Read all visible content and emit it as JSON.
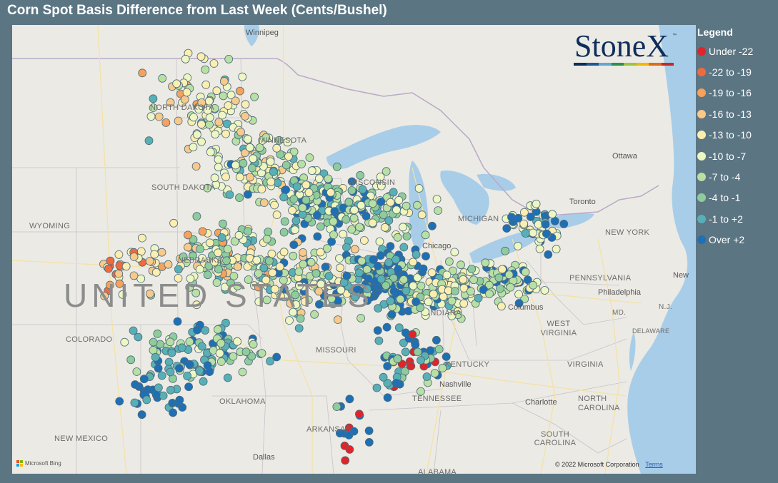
{
  "title": "Corn Spot Basis Difference from Last Week (Cents/Bushel)",
  "logo": {
    "text": "StoneX",
    "tm": "™",
    "bar_colors": [
      "#0e2d5a",
      "#1d5a99",
      "#5fa8d3",
      "#2f8f4e",
      "#9bc53d",
      "#f2b705",
      "#e06c1b",
      "#c62828"
    ]
  },
  "legend": {
    "title": "Legend",
    "items": [
      {
        "label": "Under -22",
        "color": "#e0242a"
      },
      {
        "label": "-22 to -19",
        "color": "#ee6a40"
      },
      {
        "label": "-19 to -16",
        "color": "#f6a15c"
      },
      {
        "label": "-16 to -13",
        "color": "#f8c98a"
      },
      {
        "label": "-13 to -10",
        "color": "#fbeeb0"
      },
      {
        "label": "-10 to -7",
        "color": "#eef6c4"
      },
      {
        "label": "-7 to -4",
        "color": "#b9e0a4"
      },
      {
        "label": "-4 to -1",
        "color": "#8fcc9c"
      },
      {
        "label": "-1 to +2",
        "color": "#58b0b6"
      },
      {
        "label": "Over +2",
        "color": "#1f6fb5"
      }
    ]
  },
  "map": {
    "country_label": "UNITED STATES",
    "state_labels": [
      {
        "id": "north-dakota",
        "text": "NORTH DAKOTA"
      },
      {
        "id": "minnesota",
        "text": "MINNESOTA"
      },
      {
        "id": "south-dakota",
        "text": "SOUTH DAKOTA"
      },
      {
        "id": "wyoming",
        "text": "WYOMING"
      },
      {
        "id": "nebraska",
        "text": "NEBRASKA"
      },
      {
        "id": "colorado",
        "text": "COLORADO"
      },
      {
        "id": "missouri",
        "text": "MISSOURI"
      },
      {
        "id": "oklahoma",
        "text": "OKLAHOMA"
      },
      {
        "id": "new-mexico",
        "text": "NEW MEXICO"
      },
      {
        "id": "arkansas",
        "text": "ARKANSAS"
      },
      {
        "id": "kentucky",
        "text": "KENTUCKY"
      },
      {
        "id": "tennessee",
        "text": "TENNESSEE"
      },
      {
        "id": "west-virginia",
        "text": "WEST VIRGINIA"
      },
      {
        "id": "virginia",
        "text": "VIRGINIA"
      },
      {
        "id": "north-carolina",
        "text": "NORTH CAROLINA"
      },
      {
        "id": "south-carolina",
        "text": "SOUTH CAROLINA"
      },
      {
        "id": "pennsylvania",
        "text": "PENNSYLVANIA"
      },
      {
        "id": "new-york",
        "text": "NEW YORK"
      },
      {
        "id": "md",
        "text": "MD."
      },
      {
        "id": "nj",
        "text": "N.J."
      },
      {
        "id": "delaware",
        "text": "DELAWARE"
      },
      {
        "id": "wisconsin",
        "text": "WISCONSIN"
      },
      {
        "id": "michigan",
        "text": "MICHIGAN"
      },
      {
        "id": "indiana",
        "text": "INDIANA"
      },
      {
        "id": "alabama",
        "text": "ALABAMA"
      }
    ],
    "city_labels": [
      {
        "id": "winnipeg",
        "text": "Winnipeg"
      },
      {
        "id": "ottawa",
        "text": "Ottawa"
      },
      {
        "id": "toronto",
        "text": "Toronto"
      },
      {
        "id": "chicago",
        "text": "Chicago"
      },
      {
        "id": "columbus",
        "text": "Columbus"
      },
      {
        "id": "philadelphia",
        "text": "Philadelphia"
      },
      {
        "id": "new-york-city",
        "text": "New"
      },
      {
        "id": "nashville",
        "text": "Nashville"
      },
      {
        "id": "charlotte",
        "text": "Charlotte"
      },
      {
        "id": "dallas",
        "text": "Dallas"
      }
    ],
    "footer_left": "Microsoft Bing",
    "footer_copyright": "© 2022 Microsoft Corporation",
    "footer_terms": "Terms"
  }
}
